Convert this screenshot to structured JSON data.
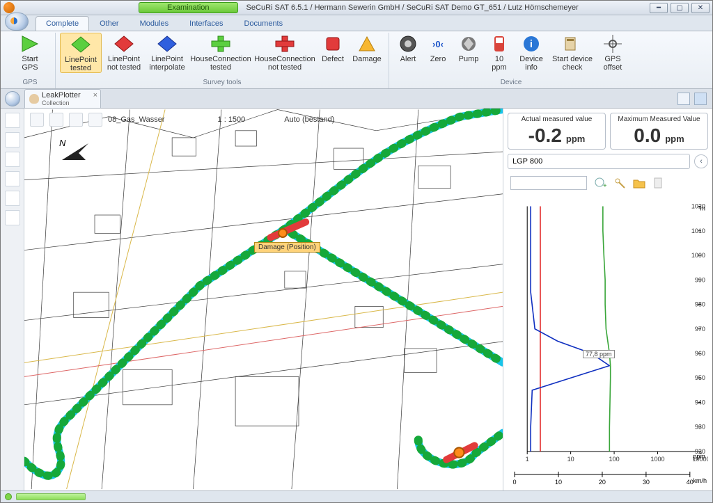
{
  "title": "SeCuRi SAT 6.5.1 / Hermann Sewerin GmbH / SeCuRi SAT Demo GT_651 / Lutz Hörnschemeyer",
  "mode_button": "Examination",
  "tabs": {
    "complete": "Complete",
    "other": "Other",
    "modules": "Modules",
    "interfaces": "Interfaces",
    "documents": "Documents"
  },
  "ribbon": {
    "gps": {
      "start": "Start\nGPS",
      "label": "GPS"
    },
    "survey": {
      "lp_tested": "LinePoint\ntested",
      "lp_not": "LinePoint\nnot tested",
      "lp_interp": "LinePoint\ninterpolate",
      "hc_tested": "HouseConnection\ntested",
      "hc_not": "HouseConnection\nnot tested",
      "defect": "Defect",
      "damage": "Damage",
      "label": "Survey tools"
    },
    "device": {
      "alert": "Alert",
      "zero": "Zero",
      "pump": "Pump",
      "ten": "10\nppm",
      "info": "Device\ninfo",
      "check": "Start device\ncheck",
      "offset": "GPS\noffset",
      "label": "Device"
    }
  },
  "doctab": {
    "name": "LeakPlotter",
    "sub": "Collection"
  },
  "map": {
    "layer": "08_Gas_Wasser",
    "scale": "1 : 1500",
    "auto": "Auto (bestand)"
  },
  "damage_label": "Damage (Position)",
  "right": {
    "actual_label": "Actual measured value",
    "actual_value": "-0.2",
    "actual_unit": "ppm",
    "max_label": "Maximum Measured Value",
    "max_value": "0.0",
    "max_unit": "ppm",
    "device_name": "LGP 800"
  },
  "chart_data": {
    "type": "line",
    "title": "",
    "xlabel": "ppm",
    "ylabel": "m",
    "xlim": [
      1,
      10000
    ],
    "ylim_m": [
      920,
      1020
    ],
    "annotation": "77,8 ppm",
    "series": [
      {
        "name": "red-threshold",
        "color": "#e02020",
        "x_const": 2
      },
      {
        "name": "blue",
        "color": "#1030c0",
        "points_m_ppm": [
          [
            1020,
            1.2
          ],
          [
            1000,
            1.2
          ],
          [
            985,
            1.2
          ],
          [
            970,
            1.5
          ],
          [
            965,
            5
          ],
          [
            960,
            30
          ],
          [
            955,
            77.8
          ],
          [
            950,
            10
          ],
          [
            945,
            1.3
          ],
          [
            930,
            1.2
          ],
          [
            920,
            1.2
          ]
        ]
      },
      {
        "name": "green",
        "color": "#3aa63a",
        "points_m_ppm": [
          [
            1020,
            55
          ],
          [
            1010,
            55
          ],
          [
            1000,
            58
          ],
          [
            990,
            62
          ],
          [
            980,
            62
          ],
          [
            970,
            65
          ],
          [
            960,
            78
          ],
          [
            955,
            82
          ],
          [
            950,
            82
          ],
          [
            940,
            80
          ],
          [
            930,
            78
          ],
          [
            920,
            78
          ]
        ]
      }
    ],
    "x_ticks": [
      1,
      10,
      100,
      1000,
      10000
    ],
    "km_axis": {
      "label": "km/h",
      "ticks": [
        0,
        10,
        20,
        30,
        40
      ],
      "max": 40
    }
  }
}
